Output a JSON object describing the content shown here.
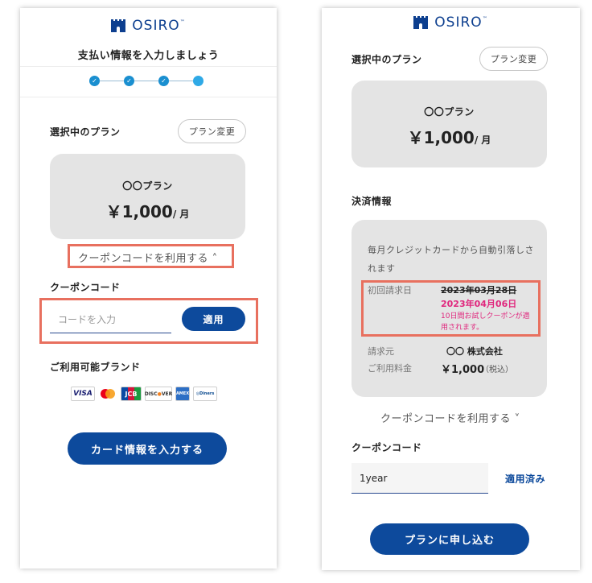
{
  "brand": {
    "logo_text": "OSIRO",
    "tm": "™"
  },
  "left": {
    "page_title": "支払い情報を入力しましょう",
    "steps": [
      "done",
      "done",
      "done",
      "current"
    ],
    "selected_plan_label": "選択中のプラン",
    "change_plan_label": "プラン変更",
    "plan_name": "〇〇プラン",
    "plan_price": "￥1,000",
    "plan_unit": "/ 月",
    "coupon_toggle": "クーポンコードを利用する",
    "coupon_label": "クーポンコード",
    "coupon_placeholder": "コードを入力",
    "apply_label": "適用",
    "brands_label": "ご利用可能ブランド",
    "brands": [
      "VISA",
      "Mastercard",
      "JCB",
      "DISCOVER",
      "AMEX",
      "Diners Club"
    ],
    "cta_label": "カード情報を入力する"
  },
  "right": {
    "selected_plan_label": "選択中のプラン",
    "change_plan_label": "プラン変更",
    "plan_name": "〇〇プラン",
    "plan_price": "￥1,000",
    "plan_unit": "/ 月",
    "payment_info_label": "決済情報",
    "payment_desc": "毎月クレジットカードから自動引落しされます",
    "first_billing_label": "初回請求日",
    "first_billing_old": "2023年03月28日",
    "first_billing_new": "2023年04月06日",
    "trial_note": "10日間お試しクーポンが適用されます。",
    "biller_label": "請求元",
    "biller_value": "〇〇 株式会社",
    "fee_label": "ご利用料金",
    "fee_value": "￥1,000",
    "fee_tax": "（税込）",
    "coupon_toggle": "クーポンコードを利用する",
    "coupon_label": "クーポンコード",
    "coupon_value": "1year",
    "applied_label": "適用済み",
    "cta_label": "プランに申し込む"
  },
  "colors": {
    "brand_navy": "#0d4a9c",
    "step_blue": "#1a8fd0",
    "highlight": "#e8705f",
    "pink": "#e0267d",
    "card_grey": "#e4e4e4"
  },
  "icons": [
    "castle-logo-icon",
    "check-icon",
    "chevron-up-icon",
    "chevron-down-icon"
  ]
}
